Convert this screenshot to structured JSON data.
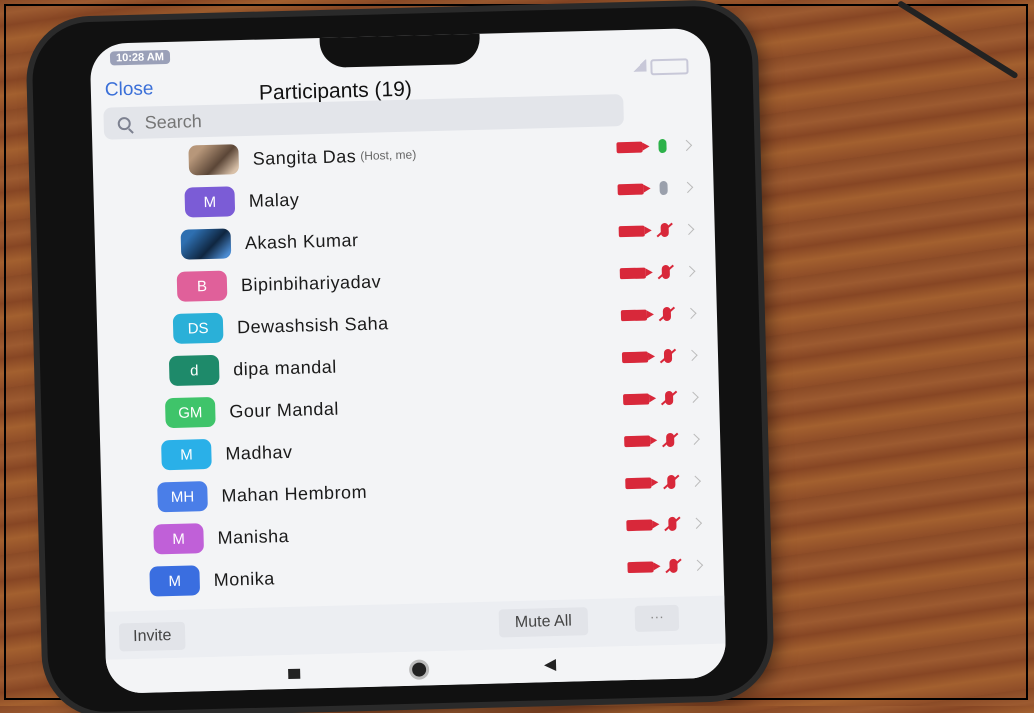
{
  "status": {
    "time": "10:28 AM"
  },
  "header": {
    "close_label": "Close",
    "title": "Participants (19)"
  },
  "search": {
    "placeholder": "Search"
  },
  "participants": [
    {
      "name": "Sangita Das",
      "note": "(Host, me)",
      "initials": "",
      "avatar_color": "",
      "photo": true,
      "mic": "on"
    },
    {
      "name": "Malay",
      "note": "",
      "initials": "M",
      "avatar_color": "#7b5cd6",
      "photo": false,
      "mic": "idle"
    },
    {
      "name": "Akash Kumar",
      "note": "",
      "initials": "",
      "avatar_color": "",
      "photo": true,
      "mic": "muted"
    },
    {
      "name": "Bipinbihariyadav",
      "note": "",
      "initials": "B",
      "avatar_color": "#e0609a",
      "photo": false,
      "mic": "muted"
    },
    {
      "name": "Dewashsish Saha",
      "note": "",
      "initials": "DS",
      "avatar_color": "#2ab0d8",
      "photo": false,
      "mic": "muted"
    },
    {
      "name": "dipa mandal",
      "note": "",
      "initials": "d",
      "avatar_color": "#1e8a6a",
      "photo": false,
      "mic": "muted"
    },
    {
      "name": "Gour Mandal",
      "note": "",
      "initials": "GM",
      "avatar_color": "#3fc46a",
      "photo": false,
      "mic": "muted"
    },
    {
      "name": "Madhav",
      "note": "",
      "initials": "M",
      "avatar_color": "#2ab0e8",
      "photo": false,
      "mic": "muted"
    },
    {
      "name": "Mahan Hembrom",
      "note": "",
      "initials": "MH",
      "avatar_color": "#4a7ee8",
      "photo": false,
      "mic": "muted"
    },
    {
      "name": "Manisha",
      "note": "",
      "initials": "M",
      "avatar_color": "#c060d8",
      "photo": false,
      "mic": "muted"
    },
    {
      "name": "Monika",
      "note": "",
      "initials": "M",
      "avatar_color": "#3a6ee0",
      "photo": false,
      "mic": "muted"
    }
  ],
  "footer": {
    "invite_label": "Invite",
    "mute_all_label": "Mute All",
    "more_label": "···"
  }
}
